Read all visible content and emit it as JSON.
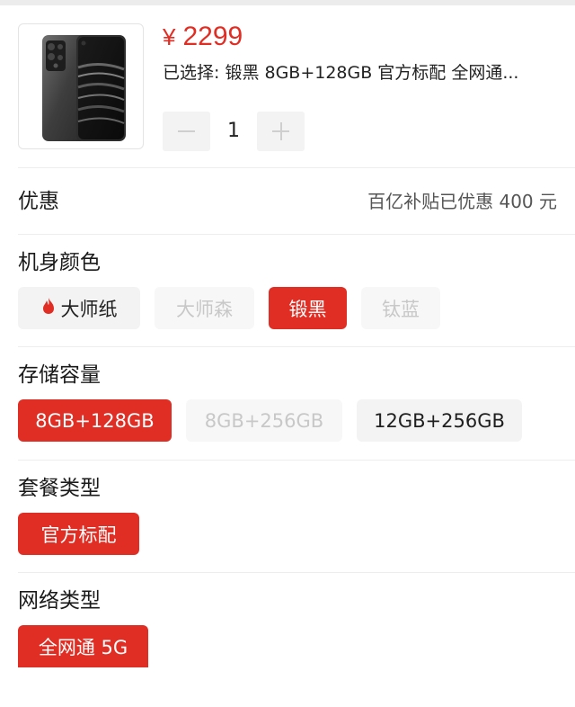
{
  "product": {
    "currency_symbol": "¥",
    "price": "2299",
    "selected_text": "已选择: 锻黑 8GB+128GB 官方标配 全网通...",
    "quantity": "1",
    "minus_label": "−",
    "plus_label": "+"
  },
  "discount": {
    "label": "优惠",
    "value": "百亿补贴已优惠 400 元"
  },
  "color_section": {
    "title": "机身颜色",
    "options": [
      {
        "label": "大师纸",
        "state": "normal",
        "icon": "flame-icon"
      },
      {
        "label": "大师森",
        "state": "disabled"
      },
      {
        "label": "锻黑",
        "state": "active"
      },
      {
        "label": "钛蓝",
        "state": "disabled"
      }
    ]
  },
  "storage_section": {
    "title": "存储容量",
    "options": [
      {
        "label": "8GB+128GB",
        "state": "active"
      },
      {
        "label": "8GB+256GB",
        "state": "disabled"
      },
      {
        "label": "12GB+256GB",
        "state": "normal"
      }
    ]
  },
  "package_section": {
    "title": "套餐类型",
    "options": [
      {
        "label": "官方标配",
        "state": "active"
      }
    ]
  },
  "network_section": {
    "title": "网络类型",
    "options": [
      {
        "label": "全网通 5G",
        "state": "active"
      }
    ]
  },
  "colors": {
    "accent": "#e02e24",
    "chip_bg": "#f3f3f3",
    "disabled_text": "#c8c8c8"
  }
}
